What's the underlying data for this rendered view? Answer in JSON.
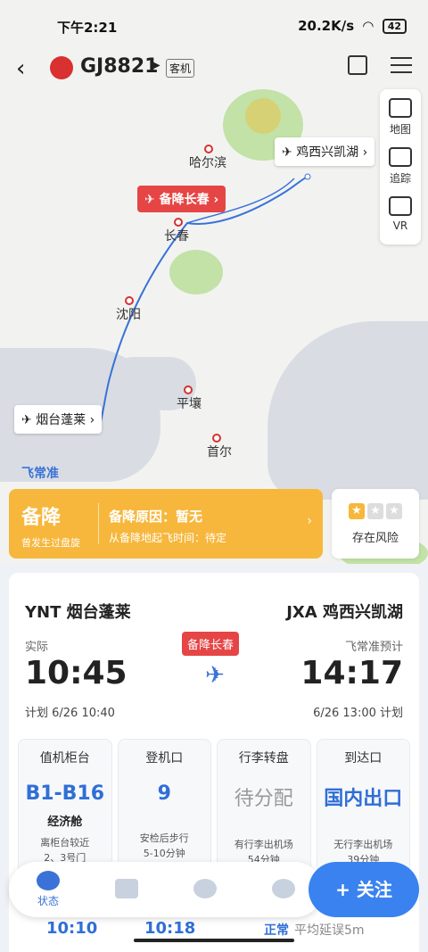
{
  "status_bar": {
    "time": "下午2:21",
    "speed": "20.2K/s",
    "battery": "42"
  },
  "header": {
    "flight_no": "GJ8821",
    "aircraft_type": "客机"
  },
  "tools": [
    {
      "label": "地图"
    },
    {
      "label": "追踪"
    },
    {
      "label": "VR"
    }
  ],
  "map": {
    "cities": [
      "哈尔滨",
      "长春",
      "沈阳",
      "平壤",
      "首尔"
    ],
    "dest_airport": "鸡西兴凯湖",
    "origin_airport": "烟台蓬莱",
    "divert_tag": "备降长春",
    "brand": "飞常准"
  },
  "status": {
    "main": "备降",
    "sub": "曾发生过盘旋",
    "reason": "备降原因：暂无",
    "reason_sub": "从备降地起飞时间：待定",
    "risk": "存在风险"
  },
  "flight": {
    "dep_name": "YNT 烟台蓬莱",
    "arr_name": "JXA 鸡西兴凯湖",
    "dep_label": "实际",
    "arr_label": "飞常准预计",
    "dep_time": "10:45",
    "arr_time": "14:17",
    "dep_plan": "计划 6/26 10:40",
    "arr_plan": "6/26 13:00 计划",
    "mid_tag": "备降长春"
  },
  "info": [
    {
      "title": "值机柜台",
      "value": "B1-B16",
      "cls": "经济舱",
      "note": "离柜台较近\n2、3号门"
    },
    {
      "title": "登机口",
      "value": "9",
      "cls": "",
      "note": "安检后步行\n5-10分钟"
    },
    {
      "title": "行李转盘",
      "value": "待分配",
      "cls": "",
      "note": "有行李出机场\n54分钟"
    },
    {
      "title": "到达口",
      "value": "国内出口",
      "cls": "",
      "note": "无行李出机场\n39分钟"
    }
  ],
  "tabs": [
    {
      "label": "状态"
    },
    {
      "label": ""
    },
    {
      "label": ""
    },
    {
      "label": ""
    }
  ],
  "follow": "+ 关注",
  "peek": {
    "t1": "10:10",
    "t2": "10:18",
    "normal": "正常",
    "delay": "平均延误5m"
  }
}
